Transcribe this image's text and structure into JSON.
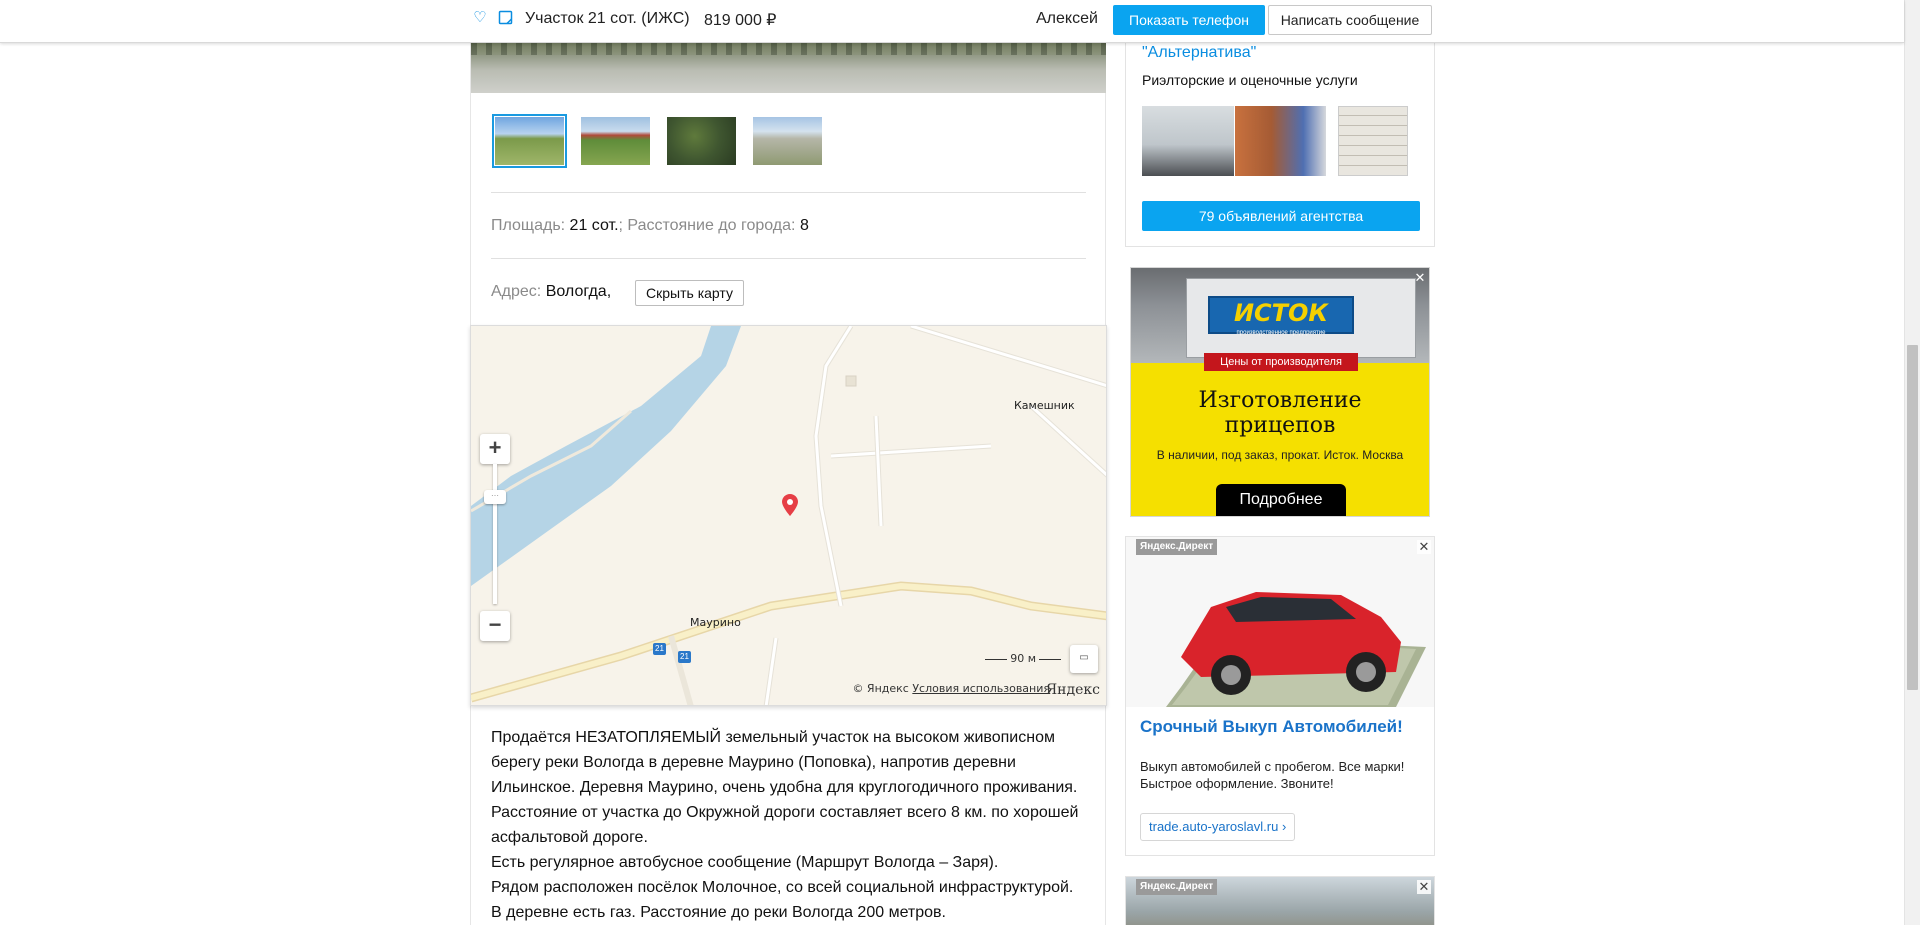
{
  "header": {
    "title": "Участок 21 сот. (ИЖС)",
    "price": "819 000  ₽",
    "seller": "Алексей",
    "show_phone_label": "Показать телефон",
    "write_message_label": "Написать сообщение"
  },
  "listing": {
    "params": {
      "area_label": "Площадь:",
      "area_value": "21 сот.",
      "separator": ";",
      "distance_label": "Расстояние до города:",
      "distance_value": "8"
    },
    "address": {
      "label": "Адрес:",
      "value": "Вологда,",
      "hide_map_label": "Скрыть карту"
    },
    "map": {
      "places": [
        "Камешник",
        "Маурино"
      ],
      "road_number": "21",
      "scale_label": "90 м",
      "copyright": "© Яндекс",
      "terms_label": "Условия использования",
      "logo": "Яндекс"
    },
    "description": [
      "Продаётся НЕЗАТОПЛЯЕМЫЙ земельный участок на высоком живописном берегу реки Вологда в деревне Маурино (Поповка), напротив деревни Ильинское. Деревня Маурино, очень удобна для круглогодичного проживания.",
      "Расстояние от участка до Окружной дороги составляет всего 8 км. по хорошей асфальтовой дороге.",
      "Есть регулярное автобусное сообщение (Маршрут Вологда – Заря).",
      "Рядом расположен посёлок Молочное, со всей социальной инфраструктурой.",
      "В деревне есть газ. Расстояние до реки Вологда 200 метров."
    ]
  },
  "agency": {
    "name": "\"Альтернатива\"",
    "kind": "Риэлторские и оценочные услуги",
    "ads_button_label": "79 объявлений агентства"
  },
  "ads": {
    "istok": {
      "logo": "ИСТОК",
      "logo_sub": "производственное предприятие",
      "ribbon": "Цены от производителя",
      "headline_line1": "Изготовление",
      "headline_line2": "прицепов",
      "sub": "В наличии, под заказ, прокат. Исток. Москва",
      "button": "Подробнее",
      "close": "✕"
    },
    "direct1": {
      "badge": "Яндекс.Директ",
      "headline": "Срочный Выкуп Автомобилей!",
      "body": "Выкуп автомобилей с пробегом. Все марки! Быстрое оформление. Звоните!",
      "link": "trade.auto-yaroslavl.ru ›",
      "close": "✕"
    },
    "direct2": {
      "badge": "Яндекс.Директ",
      "close": "✕"
    }
  },
  "icons": {
    "favorite": "heart-icon",
    "note": "note-icon",
    "map_pin": "map-pin-icon",
    "zoom_in": "plus-icon",
    "zoom_out": "minus-icon",
    "ruler": "ruler-icon"
  },
  "colors": {
    "accent": "#0aa4f0",
    "link": "#0a8de0",
    "pin": "#e63e46",
    "river": "#b5d4e6",
    "ad_yellow": "#f5e000"
  }
}
